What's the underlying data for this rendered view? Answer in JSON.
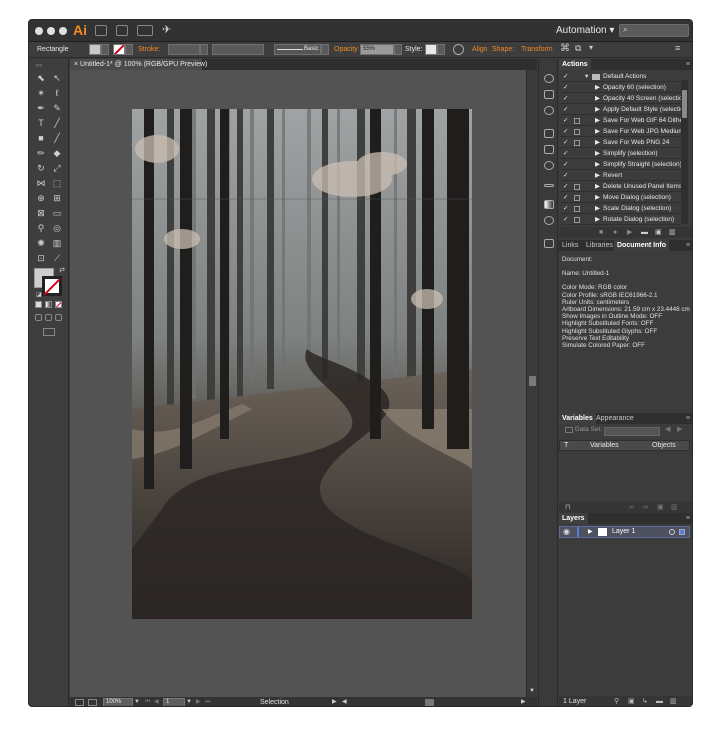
{
  "titlebar": {
    "app_logo": "Ai",
    "workspace": "Automation",
    "workspace_caret": "▾"
  },
  "control": {
    "tool_name": "Rectangle",
    "stroke_label": "Stroke:",
    "brush_label": "Basic",
    "opacity_label": "Opacity",
    "opacity_value": "55%",
    "style_label": "Style:",
    "align_label": "Align",
    "shape_label": "Shape:",
    "transform_label": "Transform"
  },
  "document": {
    "tab_label": "Untitled-1* @ 100% (RGB/GPU Preview)",
    "close": "×"
  },
  "status": {
    "zoom": "100%",
    "page": "1",
    "tool": "Selection"
  },
  "actions": {
    "tab": "Actions",
    "set_name": "Default Actions",
    "items": [
      "Opacity 60 (selection)",
      "Opacity 40 Screen (selection)",
      "Apply Default Style (selection)",
      "Save For Web GIF 64 Dithered",
      "Save For Web JPG Medium",
      "Save For Web PNG 24",
      "Simplify (selection)",
      "Simplify Straight (selection)",
      "Revert",
      "Delete Unused Panel Items",
      "Move Dialog (selection)",
      "Scale Dialog (selection)",
      "Rotate Dialog (selection)"
    ],
    "check": "✓"
  },
  "info_panel": {
    "tabs": [
      "Links",
      "Libraries",
      "Document Info"
    ],
    "heading": "Document:",
    "name_line": "Name: Untitled-1",
    "lines": [
      "Color Mode: RGB color",
      "Color Profile: sRGB IEC61966-2.1",
      "Ruler Units: centimeters",
      "Artboard Dimensions: 21.59 cm x 23.4448 cm",
      "Show Images in Outline Mode: OFF",
      "Highlight Substituted Fonts: OFF",
      "Highlight Substituted Glyphs: OFF",
      "Preserve Text Editability",
      "Simulate Colored Paper: OFF"
    ]
  },
  "variables_panel": {
    "tabs": [
      "Variables",
      "Appearance"
    ],
    "data_set_label": "Data Set:",
    "col_type": "T",
    "col_variables": "Variables",
    "col_objects": "Objects"
  },
  "layers_panel": {
    "tab": "Layers",
    "layer_name": "Layer 1",
    "footer": "1 Layer"
  },
  "colors": {
    "accent": "#f08a24",
    "panel": "#3c3c3c",
    "canvas": "#535353"
  }
}
